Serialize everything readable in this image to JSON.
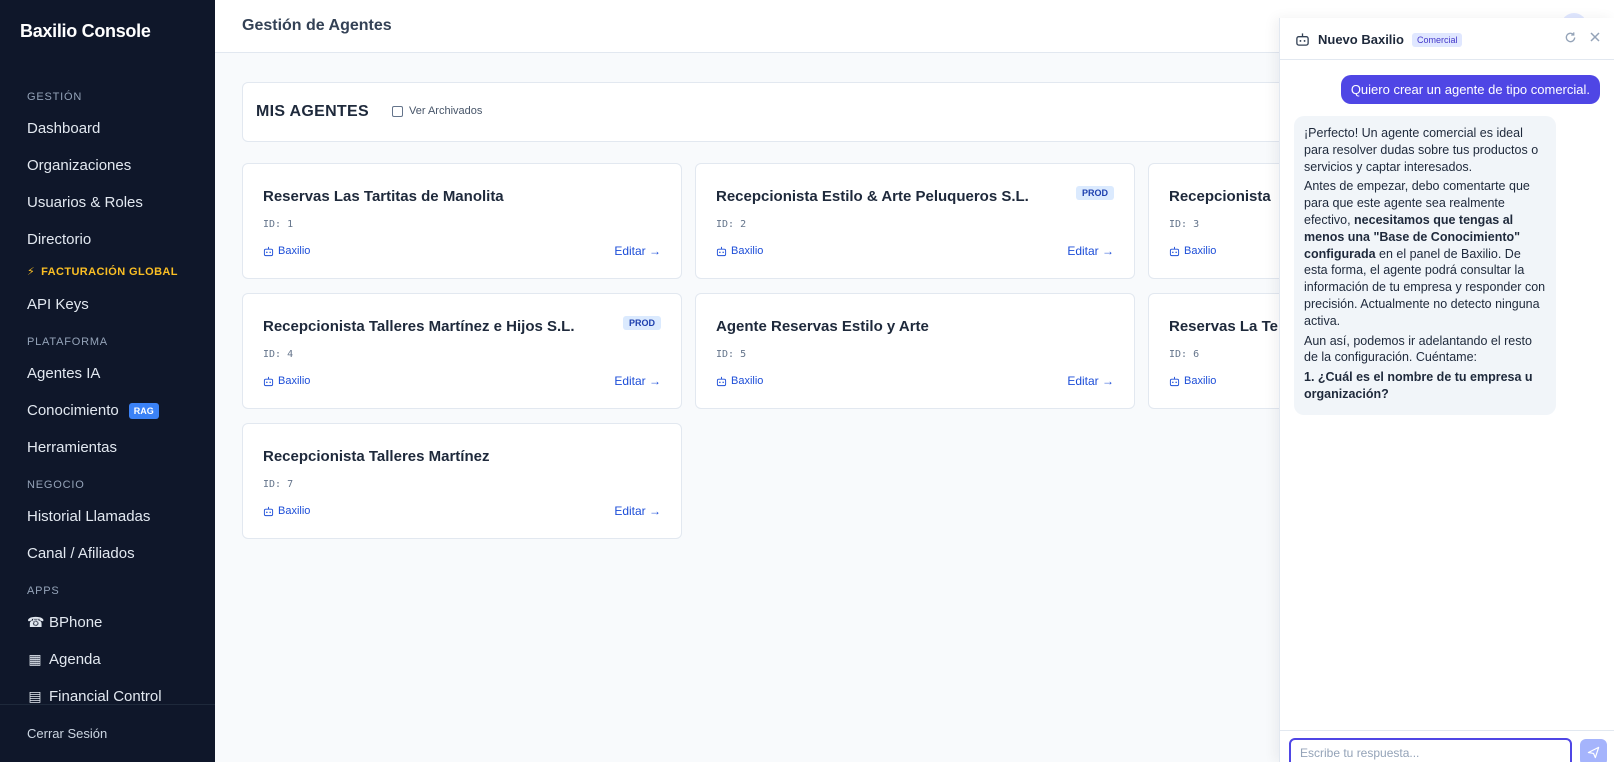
{
  "sidebar": {
    "brand": "Baxilio Console",
    "sections": {
      "gestion": "GESTIÓN",
      "plataforma": "PLATAFORMA",
      "negocio": "NEGOCIO",
      "apps": "APPS"
    },
    "items": {
      "dashboard": "Dashboard",
      "organizaciones": "Organizaciones",
      "usuarios": "Usuarios & Roles",
      "directorio": "Directorio",
      "facturacion": "FACTURACIÓN GLOBAL",
      "api_keys": "API Keys",
      "agentes": "Agentes IA",
      "conocimiento": "Conocimiento",
      "rag_badge": "RAG",
      "herramientas": "Herramientas",
      "historial": "Historial Llamadas",
      "canal": "Canal / Afiliados",
      "bphone": "BPhone",
      "agenda": "Agenda",
      "financial": "Financial Control"
    },
    "logout": "Cerrar Sesión"
  },
  "header": {
    "title": "Gestión de Agentes"
  },
  "agents_bar": {
    "title": "MIS AGENTES",
    "archived_label": "Ver Archivados"
  },
  "cards": [
    {
      "name": "Reservas Las Tartitas de Manolita",
      "id": "ID: 1",
      "owner": "Baxilio",
      "edit": "Editar →",
      "badge": ""
    },
    {
      "name": "Recepcionista Estilo & Arte Peluqueros S.L.",
      "id": "ID: 2",
      "owner": "Baxilio",
      "edit": "Editar →",
      "badge": "PROD"
    },
    {
      "name": "Recepcionista",
      "id": "ID: 3",
      "owner": "Baxilio",
      "edit": "",
      "badge": ""
    },
    {
      "name": "Recepcionista Talleres Martínez e Hijos S.L.",
      "id": "ID: 4",
      "owner": "Baxilio",
      "edit": "Editar →",
      "badge": "PROD"
    },
    {
      "name": "Agente Reservas Estilo y Arte",
      "id": "ID: 5",
      "owner": "Baxilio",
      "edit": "Editar →",
      "badge": ""
    },
    {
      "name": "Reservas La Te",
      "id": "ID: 6",
      "owner": "Baxilio",
      "edit": "",
      "badge": ""
    },
    {
      "name": "Recepcionista Talleres Martínez",
      "id": "ID: 7",
      "owner": "Baxilio",
      "edit": "Editar →",
      "badge": ""
    }
  ],
  "chat": {
    "title": "Nuevo Baxilio",
    "tag": "Comercial",
    "user_message": "Quiero crear un agente de tipo comercial.",
    "bot": {
      "p1": "¡Perfecto! Un agente comercial es ideal para resolver dudas sobre tus productos o servicios y captar interesados.",
      "p2_a": "Antes de empezar, debo comentarte que para que este agente sea realmente efectivo, ",
      "p2_b": "necesitamos que tengas al menos una \"Base de Conocimiento\" configurada",
      "p2_c": " en el panel de Baxilio. De esta forma, el agente podrá consultar la información de tu empresa y responder con precisión. Actualmente no detecto ninguna activa.",
      "p3": "Aun así, podemos ir adelantando el resto de la configuración. Cuéntame:",
      "p4": "1. ¿Cuál es el nombre de tu empresa u organización?"
    },
    "input_placeholder": "Escribe tu respuesta..."
  }
}
